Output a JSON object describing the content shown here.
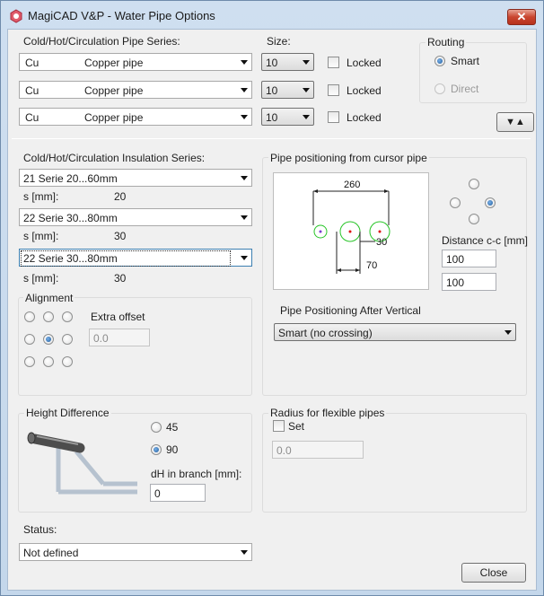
{
  "window": {
    "title": "MagiCAD V&P - Water Pipe Options",
    "close_label": "✕"
  },
  "pipe_series": {
    "label": "Cold/Hot/Circulation Pipe Series:",
    "size_label": "Size:",
    "locked_label": "Locked",
    "rows": [
      {
        "code": "Cu",
        "name": "Copper pipe",
        "size": "10",
        "locked": false
      },
      {
        "code": "Cu",
        "name": "Copper pipe",
        "size": "10",
        "locked": false
      },
      {
        "code": "Cu",
        "name": "Copper pipe",
        "size": "10",
        "locked": false
      }
    ]
  },
  "routing": {
    "title": "Routing",
    "options": [
      {
        "label": "Smart",
        "selected": true,
        "enabled": true
      },
      {
        "label": "Direct",
        "selected": false,
        "enabled": false
      }
    ]
  },
  "expand_button": {
    "label": "▼▲"
  },
  "insulation": {
    "label": "Cold/Hot/Circulation Insulation Series:",
    "s_label": "s [mm]:",
    "rows": [
      {
        "value": "21 Serie 20...60mm",
        "s": "20"
      },
      {
        "value": "22 Serie 30...80mm",
        "s": "30"
      },
      {
        "value": "22 Serie 30...80mm",
        "s": "30"
      }
    ]
  },
  "alignment": {
    "title": "Alignment",
    "extra_offset_label": "Extra offset",
    "extra_offset_value": "0.0",
    "selected_index": 4
  },
  "positioning": {
    "title": "Pipe positioning from cursor pipe",
    "dim_260": "260",
    "dim_30": "30",
    "dim_70": "70",
    "distance_label": "Distance c-c [mm]",
    "distance_1": "100",
    "distance_2": "100",
    "after_vertical_label": "Pipe Positioning After Vertical",
    "after_vertical_value": "Smart (no crossing)"
  },
  "height_difference": {
    "title": "Height Difference",
    "options": [
      {
        "label": "45",
        "selected": false
      },
      {
        "label": "90",
        "selected": true
      }
    ],
    "dh_label": "dH in branch [mm]:",
    "dh_value": "0"
  },
  "flexible": {
    "title": "Radius for flexible pipes",
    "set_label": "Set",
    "radius_value": "0.0"
  },
  "status": {
    "label": "Status:",
    "value": "Not defined"
  },
  "close_button": {
    "label": "Close"
  },
  "colors": {
    "title_bar": "#c4d7eb",
    "accent": "#1c5b9c",
    "close_red": "#c9452f",
    "circle_green": "#27c427"
  }
}
